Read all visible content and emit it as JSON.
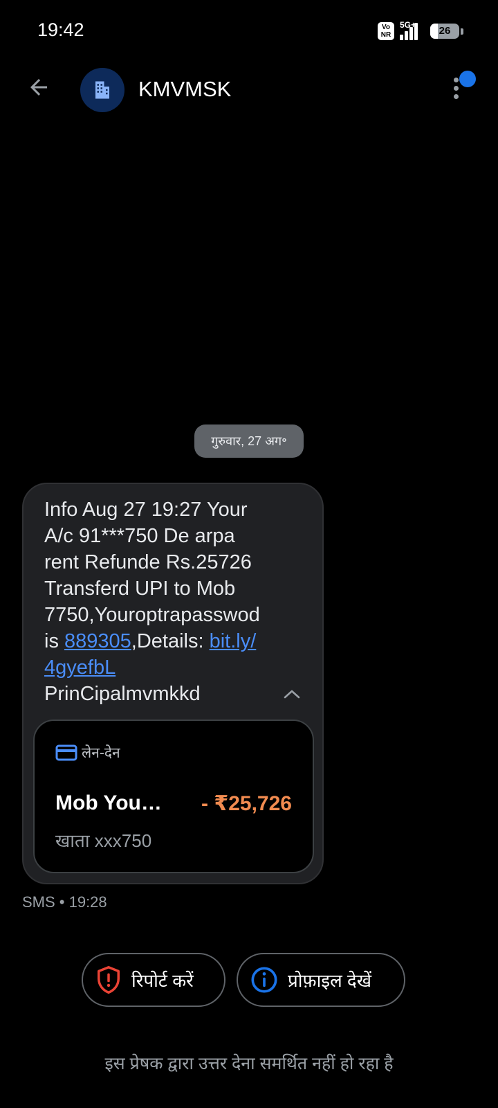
{
  "status_bar": {
    "time": "19:42",
    "volte_label": "Vo NR",
    "network_label": "5G+",
    "battery_level": "26",
    "battery_fraction": 0.26
  },
  "header": {
    "sender": "KMVMSK",
    "back_icon": "arrow-left-icon",
    "avatar_icon": "business-building-icon",
    "more_icon": "more-vert-icon",
    "notification_color": "#1a73e8"
  },
  "conversation": {
    "date_chip": "गुरुवार, 27 अग॰",
    "message": {
      "lines": [
        "Info Aug 27 19:27 Your",
        "A/c 91***750 De arpa",
        "rent Refunde Rs.25726",
        "Transferd UPI to Mob",
        "7750,Youroptrapasswod"
      ],
      "line6_prefix": "is ",
      "otp_link": "889305",
      "line6_middle": ",Details: ",
      "url_part1": "bit.ly/",
      "url_part2": "4gyefbL",
      "signature": "PrinCipalmvmkkd",
      "link_color": "#4a8df8"
    },
    "transaction_card": {
      "type_label": "लेन-देन",
      "type_icon": "credit-card-icon",
      "payee": "Mob You…",
      "amount": "- ₹25,726",
      "account": "खाता xxx750",
      "amount_color": "#f28b50"
    },
    "meta": "SMS • 19:28"
  },
  "actions": {
    "report_label": "रिपोर्ट करें",
    "report_icon": "shield-alert-icon",
    "report_color": "#ea4335",
    "profile_label": "प्रोफ़ाइल देखें",
    "profile_icon": "info-icon",
    "profile_color": "#1a73e8"
  },
  "footer": {
    "note": "इस प्रेषक द्वारा उत्तर देना समर्थित नहीं हो रहा है"
  }
}
